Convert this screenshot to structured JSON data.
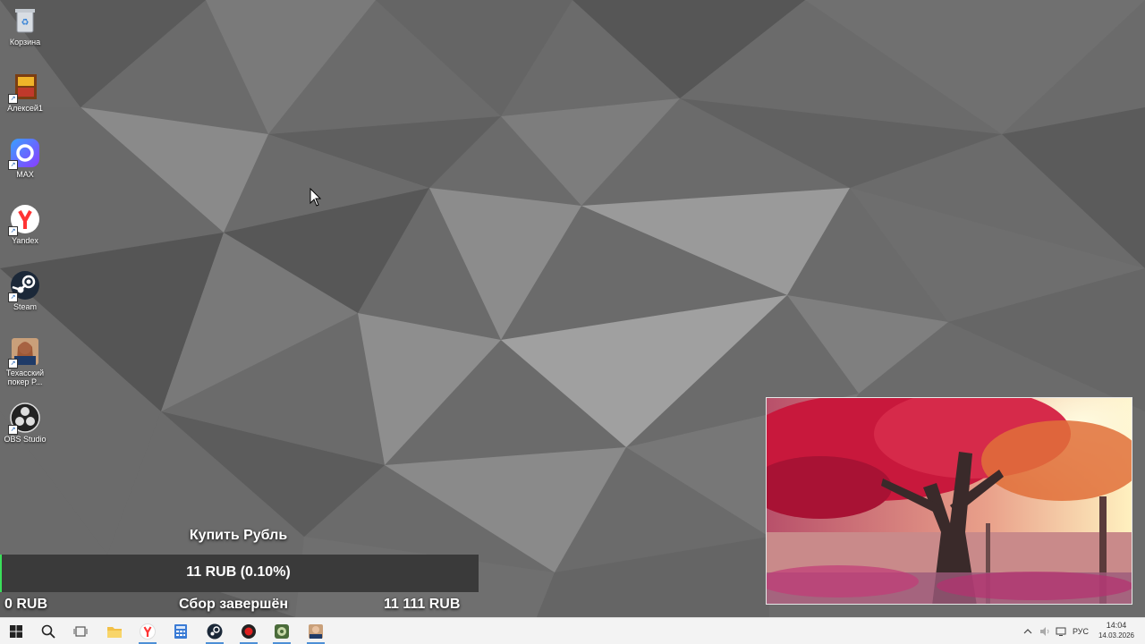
{
  "desktop": {
    "icons": [
      {
        "label": "Корзина"
      },
      {
        "label": "Алексей1"
      },
      {
        "label": "MAX"
      },
      {
        "label": "Yandex"
      },
      {
        "label": "Steam"
      },
      {
        "label": "Техасский покер P..."
      },
      {
        "label": "OBS Studio"
      }
    ]
  },
  "donation": {
    "title": "Купить Рубль",
    "amount": "11 RUB (0.10%)",
    "progress_percent": 0.1,
    "min_label": "0 RUB",
    "status": "Сбор завершён",
    "max_label": "11 111 RUB"
  },
  "taskbar": {
    "language": "РУС",
    "time": "14:04",
    "date": "14.03.2026",
    "apps": [
      "start-icon",
      "search-icon",
      "task-view-icon",
      "file-explorer-icon",
      "yandex-icon",
      "calculator-icon",
      "steam-icon",
      "record-icon",
      "game-icon",
      "poker-icon"
    ]
  },
  "colors": {
    "progress_accent": "#3adf5a",
    "taskbar_bg": "#f3f3f3"
  }
}
